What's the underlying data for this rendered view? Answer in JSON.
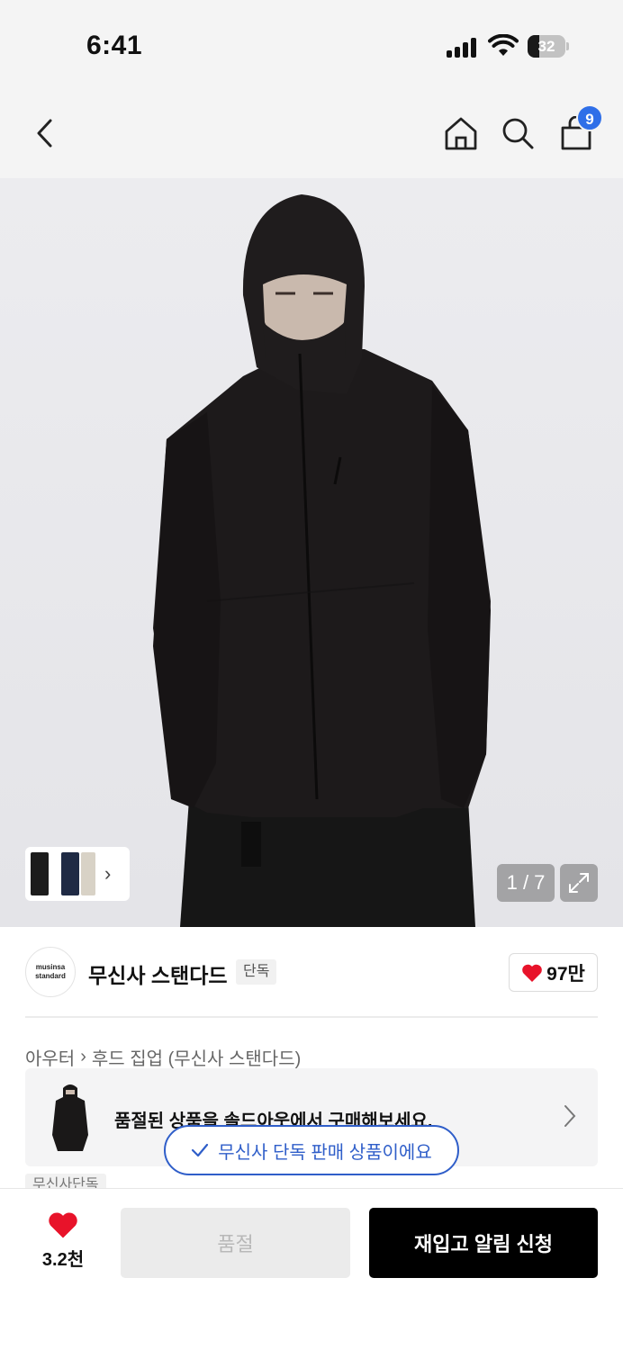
{
  "status_bar": {
    "time": "6:41",
    "battery": "32",
    "battery_level": 0.32
  },
  "nav": {
    "cart_count": "9"
  },
  "gallery": {
    "page_indicator": "1 / 7",
    "thumb_colors": [
      "#1c1c1c",
      "#1f2a44",
      "#d8d2c6"
    ]
  },
  "brand": {
    "logo_line1": "musinsa",
    "logo_line2": "standard",
    "name": "무신사 스탠다드",
    "exclusive_tag": "단독",
    "likes": "97만"
  },
  "breadcrumb": {
    "category": "아우터",
    "subcategory": "후드 집업 (무신사 스탠다드)"
  },
  "soldout_banner": {
    "text": "품절된 상품을 솔드아웃에서 구매해보세요."
  },
  "exclusive_pill": {
    "text": "무신사 단독 판매 상품이에요"
  },
  "partial_tag": "무신사단독",
  "bottom": {
    "wish_count": "3.2천",
    "soldout_label": "품절",
    "restock_label": "재입고 알림 신청"
  },
  "colors": {
    "accent_blue": "#2f5ec9",
    "badge_blue": "#2f6fe8",
    "heart_red": "#e8132a"
  }
}
